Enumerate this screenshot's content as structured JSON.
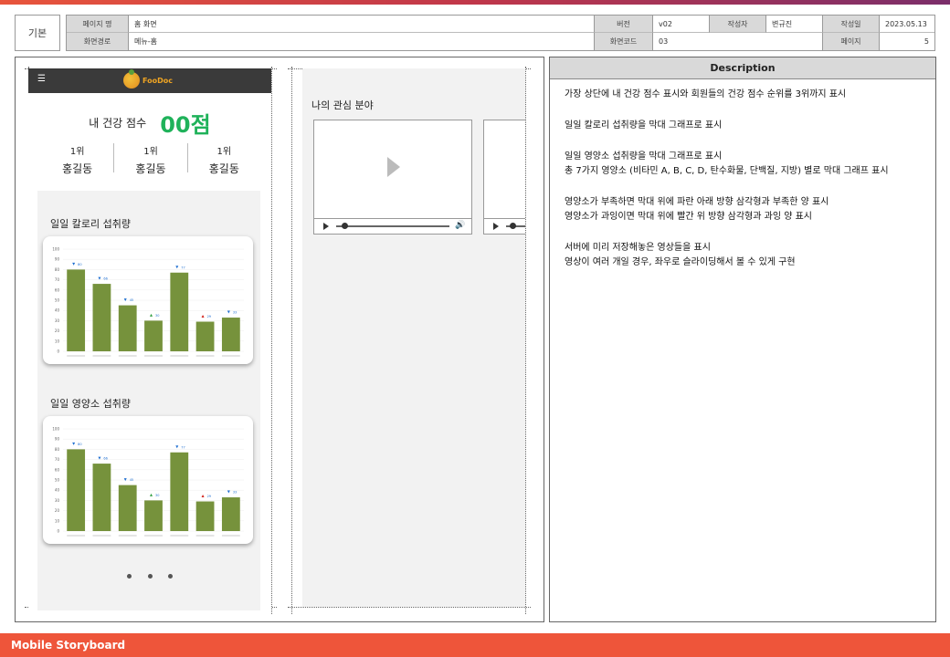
{
  "header": {
    "kind": "기본",
    "page_name_label": "페이지 명",
    "page_name": "홈 화면",
    "version_label": "버전",
    "version": "v02",
    "author_label": "작성자",
    "author": "변규진",
    "date_label": "작성일",
    "date": "2023.05.13",
    "path_label": "화면경로",
    "path": "메뉴-홈",
    "screen_code_label": "화면코드",
    "screen_code": "03",
    "page_label": "페이지",
    "page": "5"
  },
  "mobile": {
    "menu_icon": "☰",
    "logo_text": "FooDoc",
    "score_label": "내 건강 점수",
    "score_value": "00점",
    "ranks": [
      {
        "rank": "1위",
        "name": "홍길동"
      },
      {
        "rank": "1위",
        "name": "홍길동"
      },
      {
        "rank": "1위",
        "name": "홍길동"
      }
    ],
    "calorie_title": "일일 칼로리 섭취량",
    "nutrient_title": "일일 영양소 섭취량",
    "interest_title": "나의 관심 분야"
  },
  "chart_data": [
    {
      "type": "bar",
      "categories": [
        "",
        "",
        "",
        "",
        "",
        "",
        ""
      ],
      "values": [
        80,
        66,
        45,
        30,
        77,
        29,
        33
      ],
      "markers": [
        "down",
        "down",
        "down",
        "up",
        "down",
        "up",
        "down"
      ],
      "ylim": [
        0,
        100
      ],
      "yticks": [
        "0",
        "10",
        "20",
        "30",
        "40",
        "50",
        "60",
        "70",
        "80",
        "90",
        "100"
      ],
      "bar_color": "#76923c"
    },
    {
      "type": "bar",
      "categories": [
        "",
        "",
        "",
        "",
        "",
        "",
        ""
      ],
      "values": [
        80,
        66,
        45,
        30,
        77,
        29,
        33
      ],
      "markers": [
        "down",
        "down",
        "down",
        "up",
        "down",
        "up",
        "down"
      ],
      "ylim": [
        0,
        100
      ],
      "yticks": [
        "0",
        "10",
        "20",
        "30",
        "40",
        "50",
        "60",
        "70",
        "80",
        "90",
        "100"
      ],
      "bar_color": "#76923c"
    }
  ],
  "description": {
    "title": "Description",
    "lines": [
      "가장 상단에 내 건강 점수 표시와 회원들의 건강 점수 순위를 3위까지 표시",
      "",
      "일일 칼로리 섭취량을 막대 그래프로 표시",
      "",
      "일일 영양소 섭취량을 막대 그래프로 표시",
      "총 7가지 영양소 (비타민 A, B, C, D, 탄수화물, 단백질, 지방) 별로 막대 그래프 표시",
      "",
      "영양소가 부족하면 막대 위에 파란 아래 방향 삼각형과 부족한 양 표시",
      "영양소가 과잉이면 막대 위에 빨간 위 방향 삼각형과 과잉 양 표시",
      "",
      "서버에 미리 저장해놓은 영상들을 표시",
      "영상이 여러 개일 경우, 좌우로 슬라이딩해서 볼 수 있게 구현"
    ]
  },
  "footer": {
    "title": "Mobile Storyboard"
  }
}
